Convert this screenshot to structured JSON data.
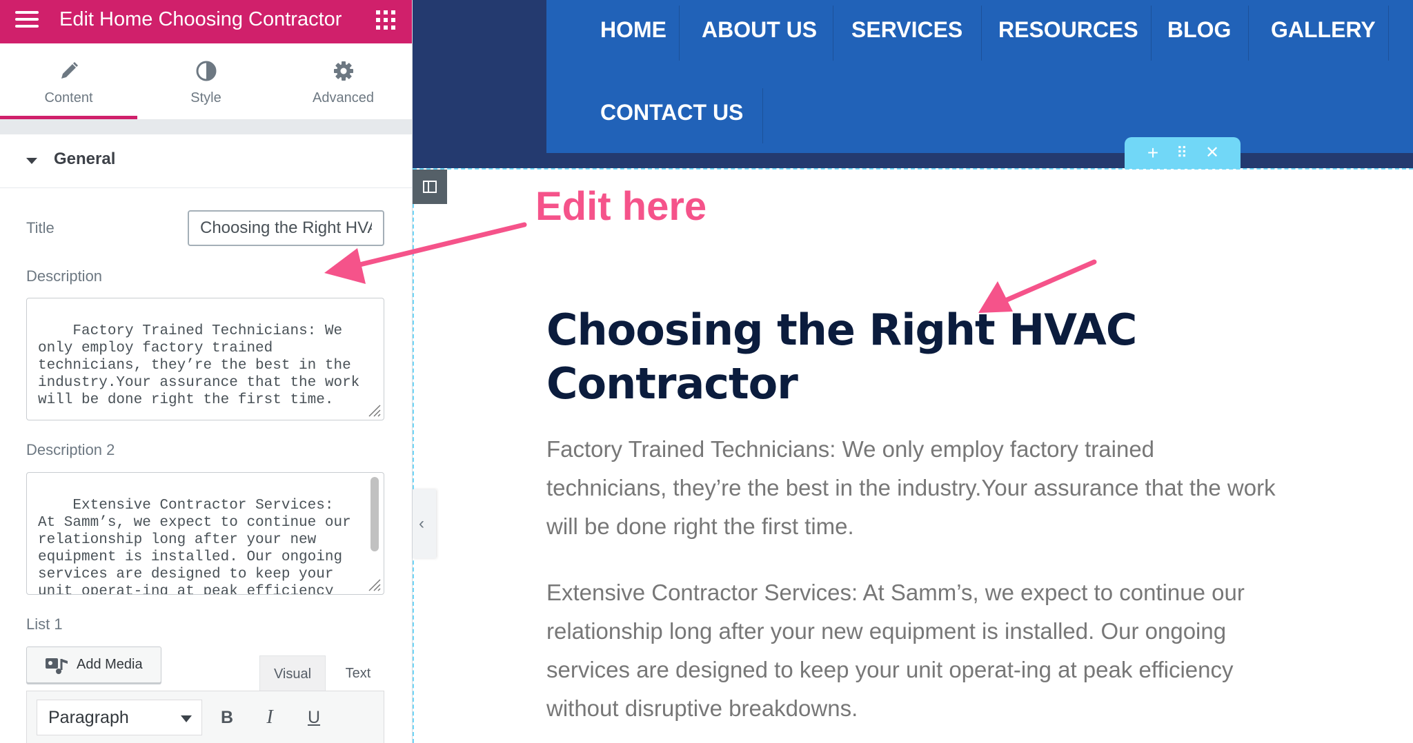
{
  "panel": {
    "header_title": "Edit Home Choosing Contractor",
    "tabs": [
      {
        "label": "Content",
        "icon": "pencil-icon",
        "active": true
      },
      {
        "label": "Style",
        "icon": "half-circle-icon",
        "active": false
      },
      {
        "label": "Advanced",
        "icon": "gear-icon",
        "active": false
      }
    ],
    "section_title": "General",
    "title_label": "Title",
    "title_value": "Choosing the Right HVAC Contractor",
    "description_label": "Description",
    "description_value": "Factory Trained Technicians: We only employ factory trained technicians, they’re the best in the industry.Your assurance that the work will be done right the first time.",
    "description2_label": "Description 2",
    "description2_value": "Extensive Contractor Services: At Samm’s, we expect to continue our relationship long after your new equipment is installed. Our ongoing services are designed to keep your unit operat-ing at peak efficiency without disruptive breakdowns.",
    "list1_label": "List 1",
    "add_media_label": "Add Media",
    "editor_tabs": {
      "visual": "Visual",
      "text": "Text"
    },
    "format_value": "Paragraph",
    "toolbar": {
      "bold": "B",
      "italic": "I",
      "underline": "U"
    }
  },
  "preview": {
    "nav": [
      "HOME",
      "ABOUT US",
      "SERVICES",
      "RESOURCES",
      "BLOG",
      "GALLERY",
      "CONTACT US"
    ],
    "handle": {
      "add": "+",
      "move": "⠿",
      "close": "✕"
    },
    "heading": "Choosing the Right HVAC Contractor",
    "paragraph1": "Factory Trained Technicians: We only employ factory trained technicians, they’re the best in the industry.Your assurance that the work will be done right the first time.",
    "paragraph2": "Extensive Contractor Services: At Samm’s, we expect to continue our relationship long after your new equipment is installed. Our ongoing services are designed to keep your unit operat-ing at peak efficiency without disruptive breakdowns.",
    "collapse_glyph": "‹"
  },
  "annotation": {
    "text": "Edit here",
    "color": "#f5538a"
  },
  "colors": {
    "brand": "#d0206b",
    "nav_blue": "#2162b8",
    "nav_dark": "#243a6f",
    "guide": "#71d7f7"
  }
}
